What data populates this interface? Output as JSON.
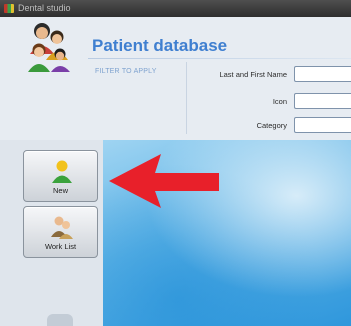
{
  "window": {
    "title": "Dental studio",
    "icon": "app-icon"
  },
  "header": {
    "logo_icon": "patients-group-icon",
    "title": "Patient database"
  },
  "filter": {
    "label": "FILTER TO APPLY",
    "fields": [
      {
        "label": "Last and First Name",
        "value": ""
      },
      {
        "label": "Icon",
        "value": ""
      },
      {
        "label": "Category",
        "value": ""
      }
    ]
  },
  "sidebar": {
    "buttons": [
      {
        "label": "New",
        "icon": "new-patient-icon"
      },
      {
        "label": "Work List",
        "icon": "work-list-icon"
      }
    ]
  },
  "annotation": {
    "arrow_icon": "red-arrow-icon",
    "arrow_color": "#e8202a"
  },
  "colors": {
    "title": "#3f7fd0",
    "filter_label": "#7ea2cf",
    "content_background": "#5fb4e6"
  }
}
